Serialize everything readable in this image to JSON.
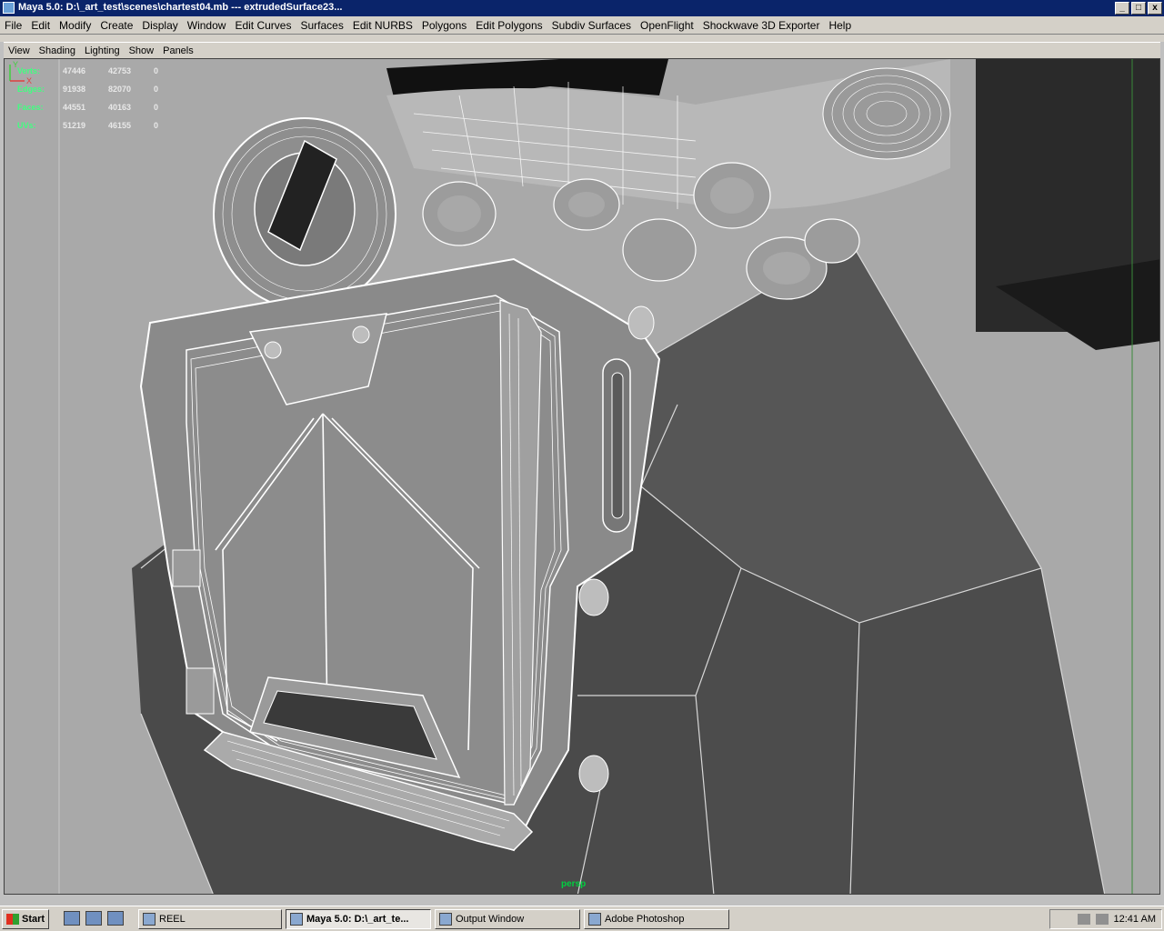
{
  "window": {
    "title": "Maya 5.0: D:\\_art_test\\scenes\\chartest04.mb   ---   extrudedSurface23...",
    "buttons": [
      "_",
      "□",
      "x"
    ]
  },
  "menubar": [
    "File",
    "Edit",
    "Modify",
    "Create",
    "Display",
    "Window",
    "Edit Curves",
    "Surfaces",
    "Edit NURBS",
    "Polygons",
    "Edit Polygons",
    "Subdiv Surfaces",
    "OpenFlight",
    "Shockwave 3D Exporter",
    "Help"
  ],
  "panel_menu": [
    "View",
    "Shading",
    "Lighting",
    "Show",
    "Panels"
  ],
  "hud": {
    "rows": [
      {
        "label": "Verts:",
        "values": [
          "47446",
          "42753",
          "0"
        ]
      },
      {
        "label": "Edges:",
        "values": [
          "91938",
          "82070",
          "0"
        ]
      },
      {
        "label": "Faces:",
        "values": [
          "44551",
          "40163",
          "0"
        ]
      },
      {
        "label": "UVs:",
        "values": [
          "51219",
          "46155",
          "0"
        ]
      }
    ]
  },
  "camera_label": "persp",
  "axis": {
    "y": "Y",
    "x": "X"
  },
  "taskbar": {
    "start": "Start",
    "items": [
      {
        "label": "REEL",
        "active": false
      },
      {
        "label": "Maya 5.0: D:\\_art_te...",
        "active": true
      },
      {
        "label": "Output Window",
        "active": false
      },
      {
        "label": "Adobe Photoshop",
        "active": false
      }
    ],
    "clock": "12:41 AM"
  }
}
